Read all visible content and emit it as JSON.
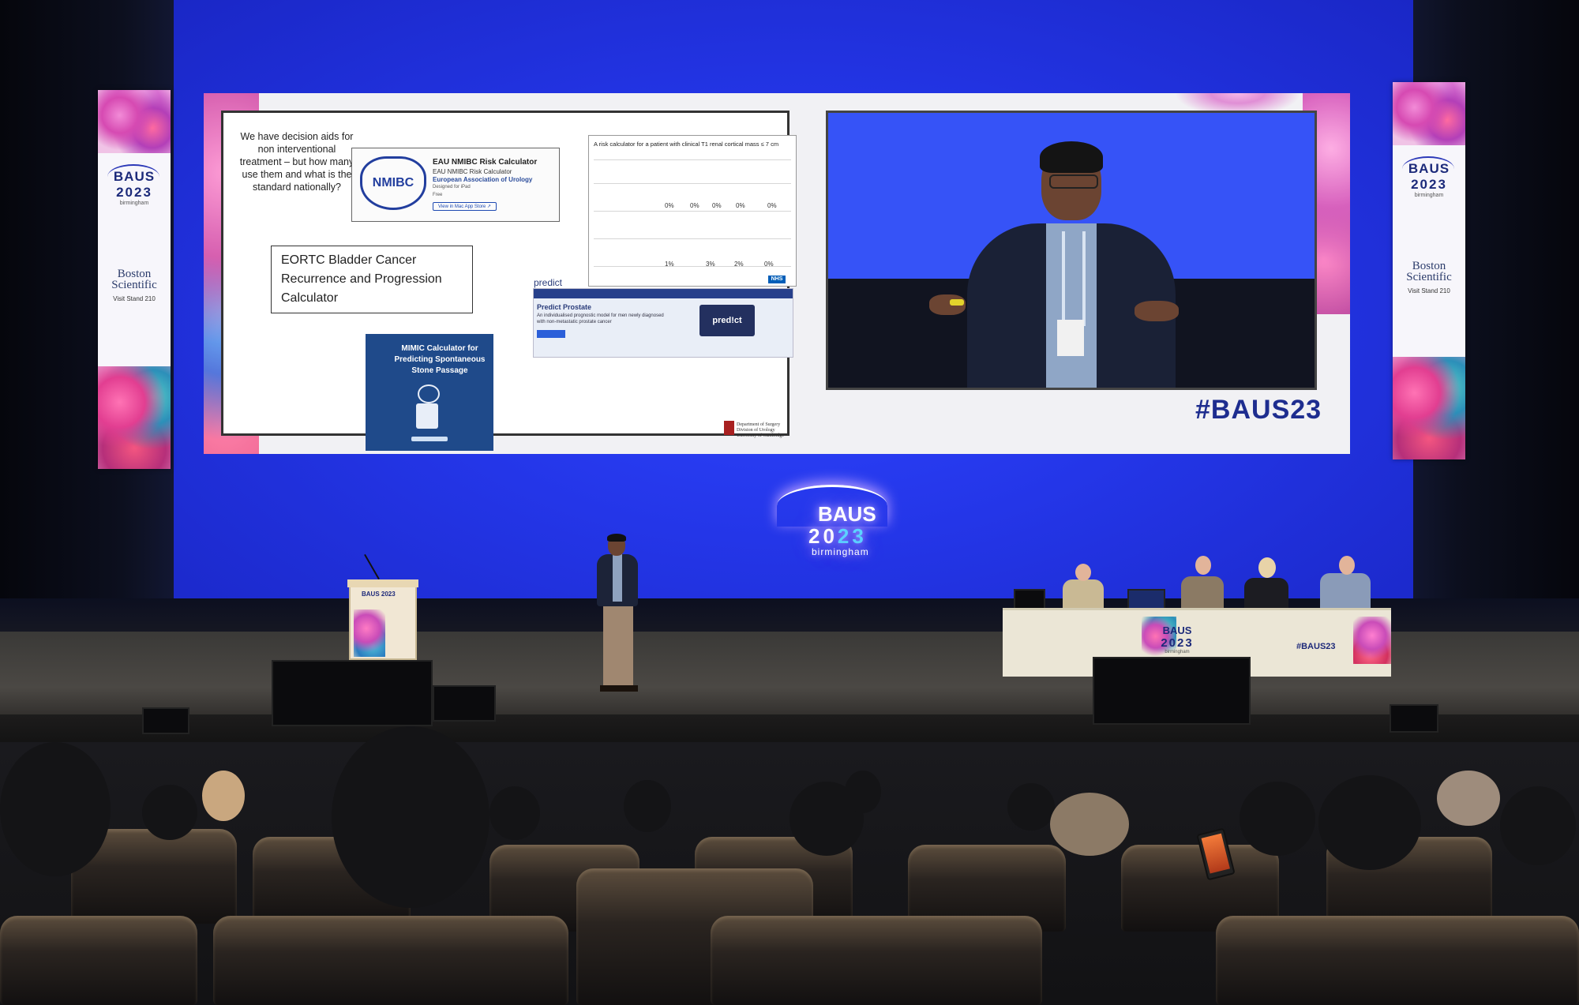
{
  "scene": {
    "event": "BAUS 2023 annual meeting, main auditorium",
    "colors": {
      "screen_blue": "#2436e8",
      "brand_navy": "#1e2d8f",
      "brand_pink": "#d246a4"
    }
  },
  "banners": {
    "title": "BAUS",
    "year": "2023",
    "city": "birmingham",
    "sponsor": "Boston Scientific",
    "stand": "Visit Stand 210"
  },
  "slide": {
    "question": "We have decision aids for non interventional treatment – but how many use them and what is the standard nationally?",
    "nmibc": {
      "logo": "NMIBC",
      "title": "EAU NMIBC Risk Calculator",
      "subtitle": "EAU NMIBC Risk Calculator",
      "org": "European Association of Urology",
      "designed_for": "Designed for iPad",
      "price": "Free",
      "button": "View in Mac App Store ↗"
    },
    "risk_calc": {
      "title": "A risk calculator for a patient with clinical T1 renal cortical mass ≤ 7 cm",
      "row1": [
        "0%",
        "0%",
        "0%",
        "0%",
        "0%"
      ],
      "row2": [
        "1%",
        "3%",
        "2%",
        "0%"
      ]
    },
    "eortc": "EORTC Bladder Cancer Recurrence and Progression Calculator",
    "mimic": "MIMIC Calculator for Predicting Spontaneous Stone Passage",
    "predict": {
      "brand": "predict",
      "nhs": "NHS",
      "heading": "Predict Prostate",
      "body": "An individualised prognostic model for men newly diagnosed with non-metastatic prostate cancer",
      "device": "pred!ct"
    },
    "cambridge": [
      "Department of Surgery",
      "Division of Urology",
      "University of Cambridge"
    ]
  },
  "screen": {
    "hashtag": "#BAUS23"
  },
  "stage": {
    "glow_logo": {
      "title": "BAUS",
      "year_a": "20",
      "year_b": "23",
      "city": "birmingham"
    },
    "podium": "BAUS 2023",
    "panel_table": {
      "title": "BAUS",
      "year": "2023",
      "city": "birmingham",
      "hashtag": "#BAUS23"
    }
  }
}
